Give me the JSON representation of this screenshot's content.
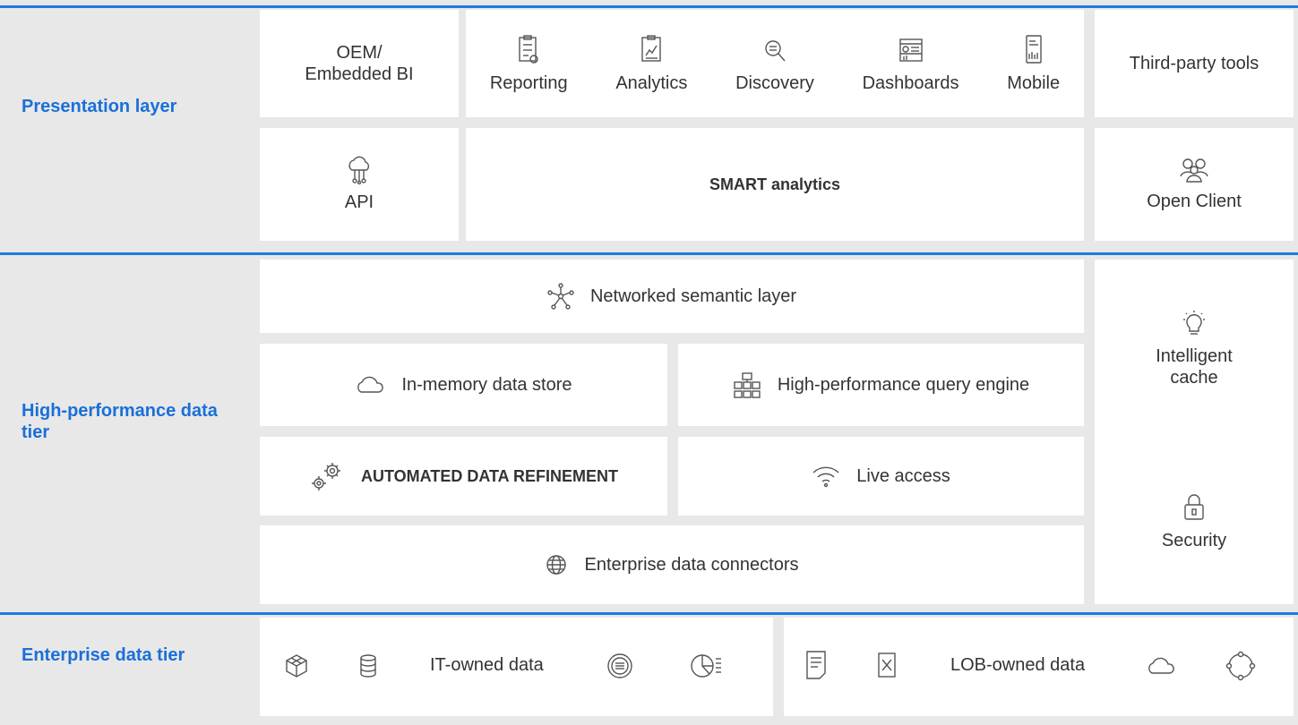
{
  "colors": {
    "accent": "#1f7ae0",
    "label": "#1a6fd9",
    "panel": "#ffffff",
    "bg": "#e8e8e8"
  },
  "bands": {
    "presentation": "Presentation layer",
    "data_tier": "High-performance data tier",
    "enterprise": "Enterprise data tier"
  },
  "presentation": {
    "oem": "OEM/ Embedded BI",
    "tools": [
      {
        "label": "Reporting",
        "icon": "clipboard-icon"
      },
      {
        "label": "Analytics",
        "icon": "chart-doc-icon"
      },
      {
        "label": "Discovery",
        "icon": "magnifier-icon"
      },
      {
        "label": "Dashboards",
        "icon": "dashboard-icon"
      },
      {
        "label": "Mobile",
        "icon": "mobile-icon"
      }
    ],
    "third_party": "Third-party tools",
    "api": "API",
    "smart": "SMART analytics",
    "open_client": "Open Client"
  },
  "data_tier": {
    "semantic": "Networked semantic layer",
    "in_memory": "In-memory data store",
    "query_engine": "High-performance query engine",
    "refinement": "AUTOMATED DATA REFINEMENT",
    "live": "Live access",
    "connectors": "Enterprise data connectors",
    "cache": "Intelligent cache",
    "security": "Security"
  },
  "enterprise": {
    "it_owned": "IT-owned data",
    "lob_owned": "LOB-owned data"
  }
}
